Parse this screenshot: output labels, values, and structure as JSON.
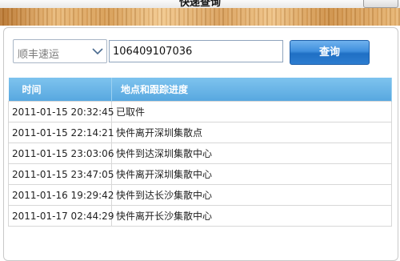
{
  "window": {
    "title": "快递查询"
  },
  "search": {
    "courier_selected": "顺丰速运",
    "tracking_number": "106409107036",
    "query_button": "查询"
  },
  "table": {
    "headers": [
      "时间",
      "地点和跟踪进度"
    ],
    "rows": [
      {
        "time": "2011-01-15 20:32:45",
        "progress": "已取件"
      },
      {
        "time": "2011-01-15 22:14:21",
        "progress": "快件离开深圳集散点"
      },
      {
        "time": "2011-01-15 23:03:06",
        "progress": "快件到达深圳集散中心"
      },
      {
        "time": "2011-01-15 23:47:05",
        "progress": "快件离开深圳集散中心"
      },
      {
        "time": "2011-01-16 19:29:42",
        "progress": "快件到达长沙集散中心"
      },
      {
        "time": "2011-01-17 02:44:29",
        "progress": "快件离开长沙集散中心"
      }
    ]
  },
  "colors": {
    "header_blue": "#58a8e0",
    "button_blue": "#2d7dd0",
    "wood": "#d79d55"
  },
  "icons": {
    "dropdown": "chevron-down-icon"
  }
}
